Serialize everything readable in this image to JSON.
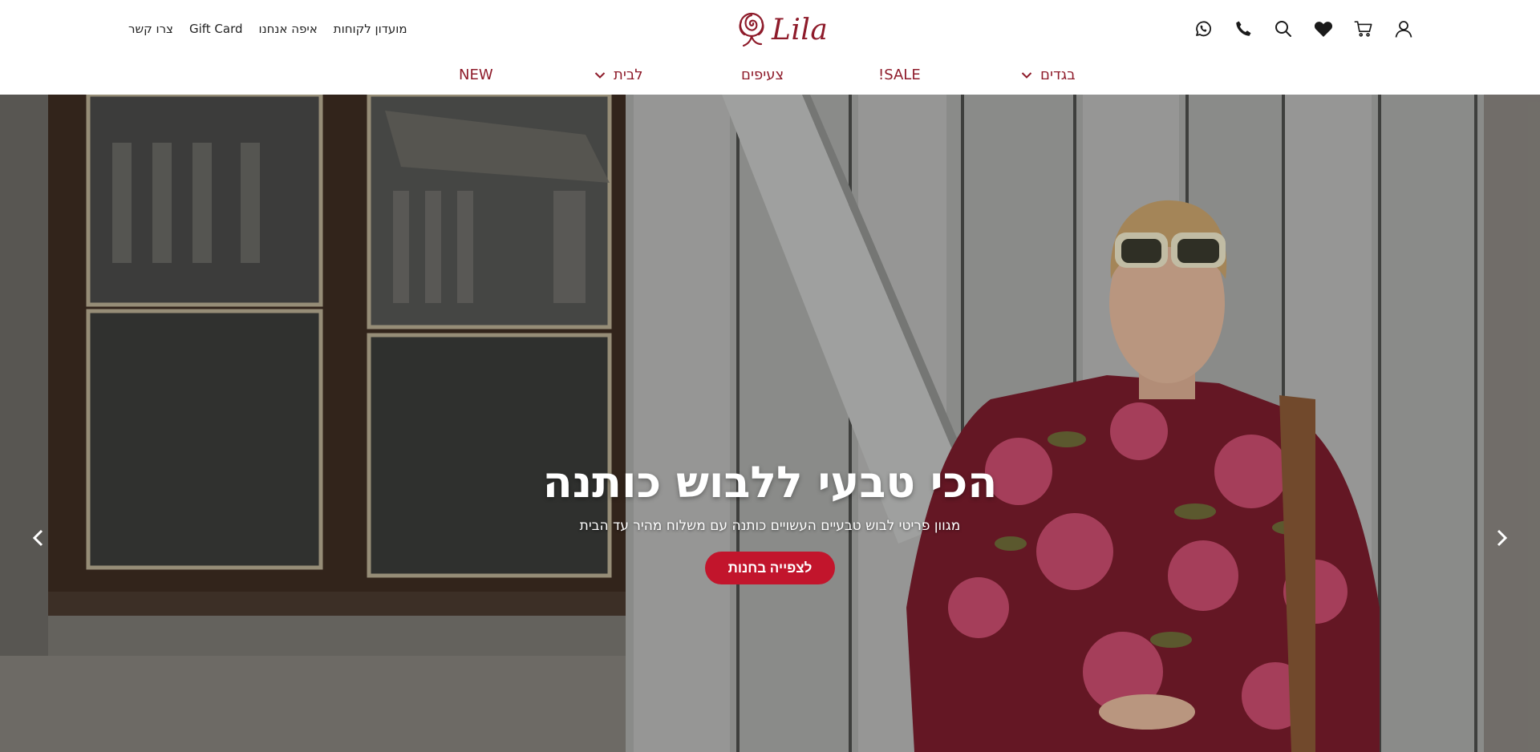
{
  "brand": {
    "logo_text": "Lila",
    "accent_color": "#8e1b2a",
    "cta_color": "#c2152c"
  },
  "top_links": [
    {
      "label": "מועדון לקוחות"
    },
    {
      "label": "איפה אנחנו"
    },
    {
      "label": "Gift Card"
    },
    {
      "label": "צרו קשר"
    }
  ],
  "header_icons": [
    "whatsapp-icon",
    "phone-icon",
    "search-icon",
    "heart-icon",
    "cart-icon",
    "user-icon"
  ],
  "nav": {
    "clothes": "בגדים",
    "sale": "SALE!",
    "scarves": "צעיפים",
    "home": "לבית",
    "new": "NEW"
  },
  "hero": {
    "title": "הכי טבעי ללבוש כותנה",
    "subtitle": "מגוון פריטי לבוש טבעיים העשויים כותנה עם משלוח מהיר עד הבית",
    "cta_label": "לצפייה בחנות"
  }
}
